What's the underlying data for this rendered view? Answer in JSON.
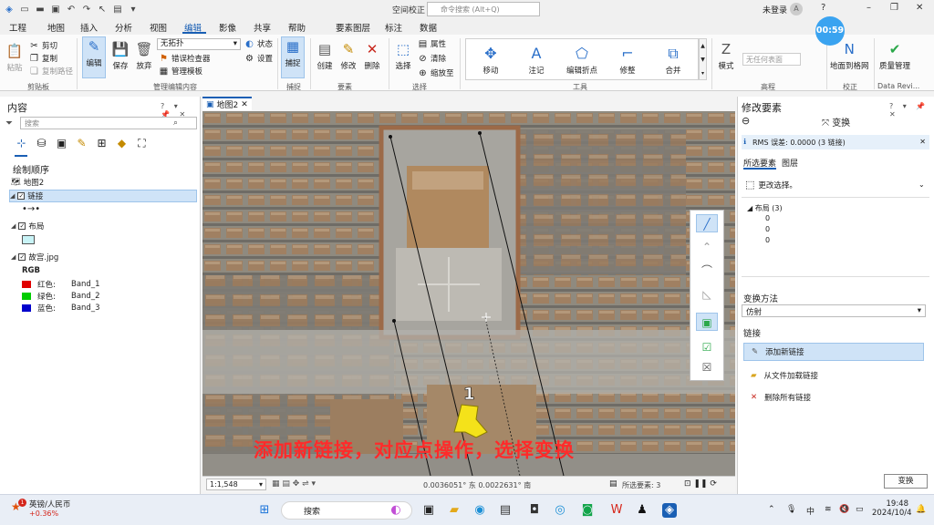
{
  "colors": {
    "accent": "#1a5fb4",
    "selection": "#cfe3f7",
    "caption_red": "#ff2a2a",
    "timer_blue": "#3aa3f0"
  },
  "titlebar": {
    "app_title": "空间校正",
    "command_search_placeholder": "命令搜索 (Alt+Q)",
    "signin": "未登录",
    "avatar": "A"
  },
  "ribbon_tabs": [
    "工程",
    "地图",
    "插入",
    "分析",
    "视图",
    "编辑",
    "影像",
    "共享",
    "帮助",
    "要素图层",
    "标注",
    "数据"
  ],
  "ribbon": {
    "clipboard": {
      "paste": "粘贴",
      "cut": "剪切",
      "copy": "复制",
      "copy_path": "复制路径",
      "label": "剪贴板"
    },
    "manage": {
      "edit": "编辑",
      "save": "保存",
      "discard": "放弃",
      "snap_value": "无拓扑",
      "error_inspector": "错误检查器",
      "manage_templates": "管理模板",
      "status": "状态",
      "settings": "设置",
      "label": "管理编辑内容"
    },
    "snapping": {
      "snap": "捕捉",
      "label": "捕捉"
    },
    "features": {
      "create": "创建",
      "modify": "修改",
      "delete": "删除",
      "label": "要素"
    },
    "selection": {
      "select": "选择",
      "attributes": "属性",
      "clear": "清除",
      "zoom_to": "缩放至",
      "label": "选择"
    },
    "tools": {
      "move": "移动",
      "annotate": "注记",
      "edit_vertices": "编辑折点",
      "reshape": "修整",
      "merge": "合并",
      "label": "工具"
    },
    "elevation": {
      "mode": "模式",
      "template_placeholder": "无任何表面",
      "label": "高程"
    },
    "correction": {
      "ground_to_grid": "地面到格网",
      "label": "校正"
    },
    "data_review": {
      "quality": "质量管理",
      "label": "Data Revi..."
    }
  },
  "timer": "00:59",
  "contents": {
    "title": "内容",
    "search_placeholder": "搜索",
    "draw_order": "绘制顺序",
    "map_name": "地图2",
    "layers": [
      {
        "name": "链接",
        "checked": true,
        "selected": true
      },
      {
        "name": "布局",
        "checked": true,
        "selected": false
      },
      {
        "name": "故宫.jpg",
        "checked": true,
        "selected": false
      }
    ],
    "rgb_label": "RGB",
    "bands": [
      {
        "channel": "红色:",
        "band": "Band_1",
        "color": "#e00000"
      },
      {
        "channel": "绿色:",
        "band": "Band_2",
        "color": "#00cc00"
      },
      {
        "channel": "蓝色:",
        "band": "Band_3",
        "color": "#0000cc"
      }
    ]
  },
  "map": {
    "tab": "地图2",
    "link_number": "1",
    "caption": "添加新链接，对应点操作，选择变换"
  },
  "statusbar": {
    "scale": "1:1,548",
    "coords": "0.0036051° 东  0.0022631° 南",
    "selected": "所选要素: 3"
  },
  "modify_pane": {
    "title": "修改要素",
    "tool_name": "变换",
    "rms": "RMS 误差: 0.0000 (3 链接)",
    "tabs": [
      "所选要素",
      "图层"
    ],
    "change_selection": "更改选择。",
    "layout_node": "布局 (3)",
    "node_items": [
      "0",
      "0",
      "0"
    ],
    "method_label": "变换方法",
    "method_value": "仿射",
    "links_label": "链接",
    "link_actions": [
      {
        "label": "添加新链接",
        "selected": true
      },
      {
        "label": "从文件加载链接",
        "selected": false
      },
      {
        "label": "删除所有链接",
        "selected": false
      }
    ],
    "transform_button": "变换"
  },
  "taskbar": {
    "fx_name": "英镑/人民币",
    "fx_change": "+0.36%",
    "fx_badge": "1",
    "search_placeholder": "搜索",
    "ime": "中",
    "time": "19:48",
    "date": "2024/10/4"
  }
}
